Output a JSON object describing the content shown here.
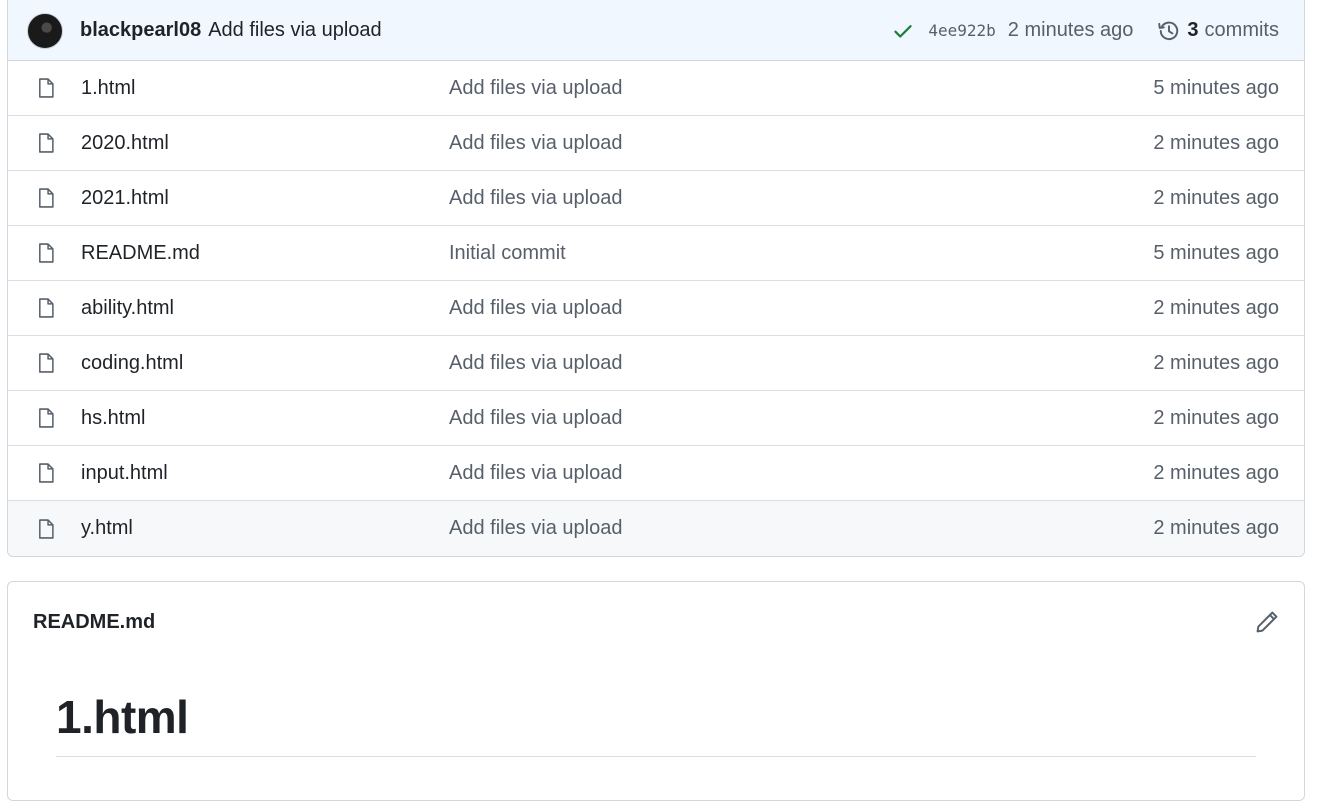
{
  "latest_commit": {
    "author": "blackpearl08",
    "message": "Add files via upload",
    "status_icon": "check-icon",
    "status_color": "#1a7f37",
    "sha": "4ee922b",
    "time": "2 minutes ago",
    "commit_count": "3",
    "commits_label": "commits"
  },
  "files": [
    {
      "name": "1.html",
      "message": "Add files via upload",
      "age": "5 minutes ago"
    },
    {
      "name": "2020.html",
      "message": "Add files via upload",
      "age": "2 minutes ago"
    },
    {
      "name": "2021.html",
      "message": "Add files via upload",
      "age": "2 minutes ago"
    },
    {
      "name": "README.md",
      "message": "Initial commit",
      "age": "5 minutes ago"
    },
    {
      "name": "ability.html",
      "message": "Add files via upload",
      "age": "2 minutes ago"
    },
    {
      "name": "coding.html",
      "message": "Add files via upload",
      "age": "2 minutes ago"
    },
    {
      "name": "hs.html",
      "message": "Add files via upload",
      "age": "2 minutes ago"
    },
    {
      "name": "input.html",
      "message": "Add files via upload",
      "age": "2 minutes ago"
    },
    {
      "name": "y.html",
      "message": "Add files via upload",
      "age": "2 minutes ago"
    }
  ],
  "readme": {
    "title": "README.md",
    "heading": "1.html"
  }
}
